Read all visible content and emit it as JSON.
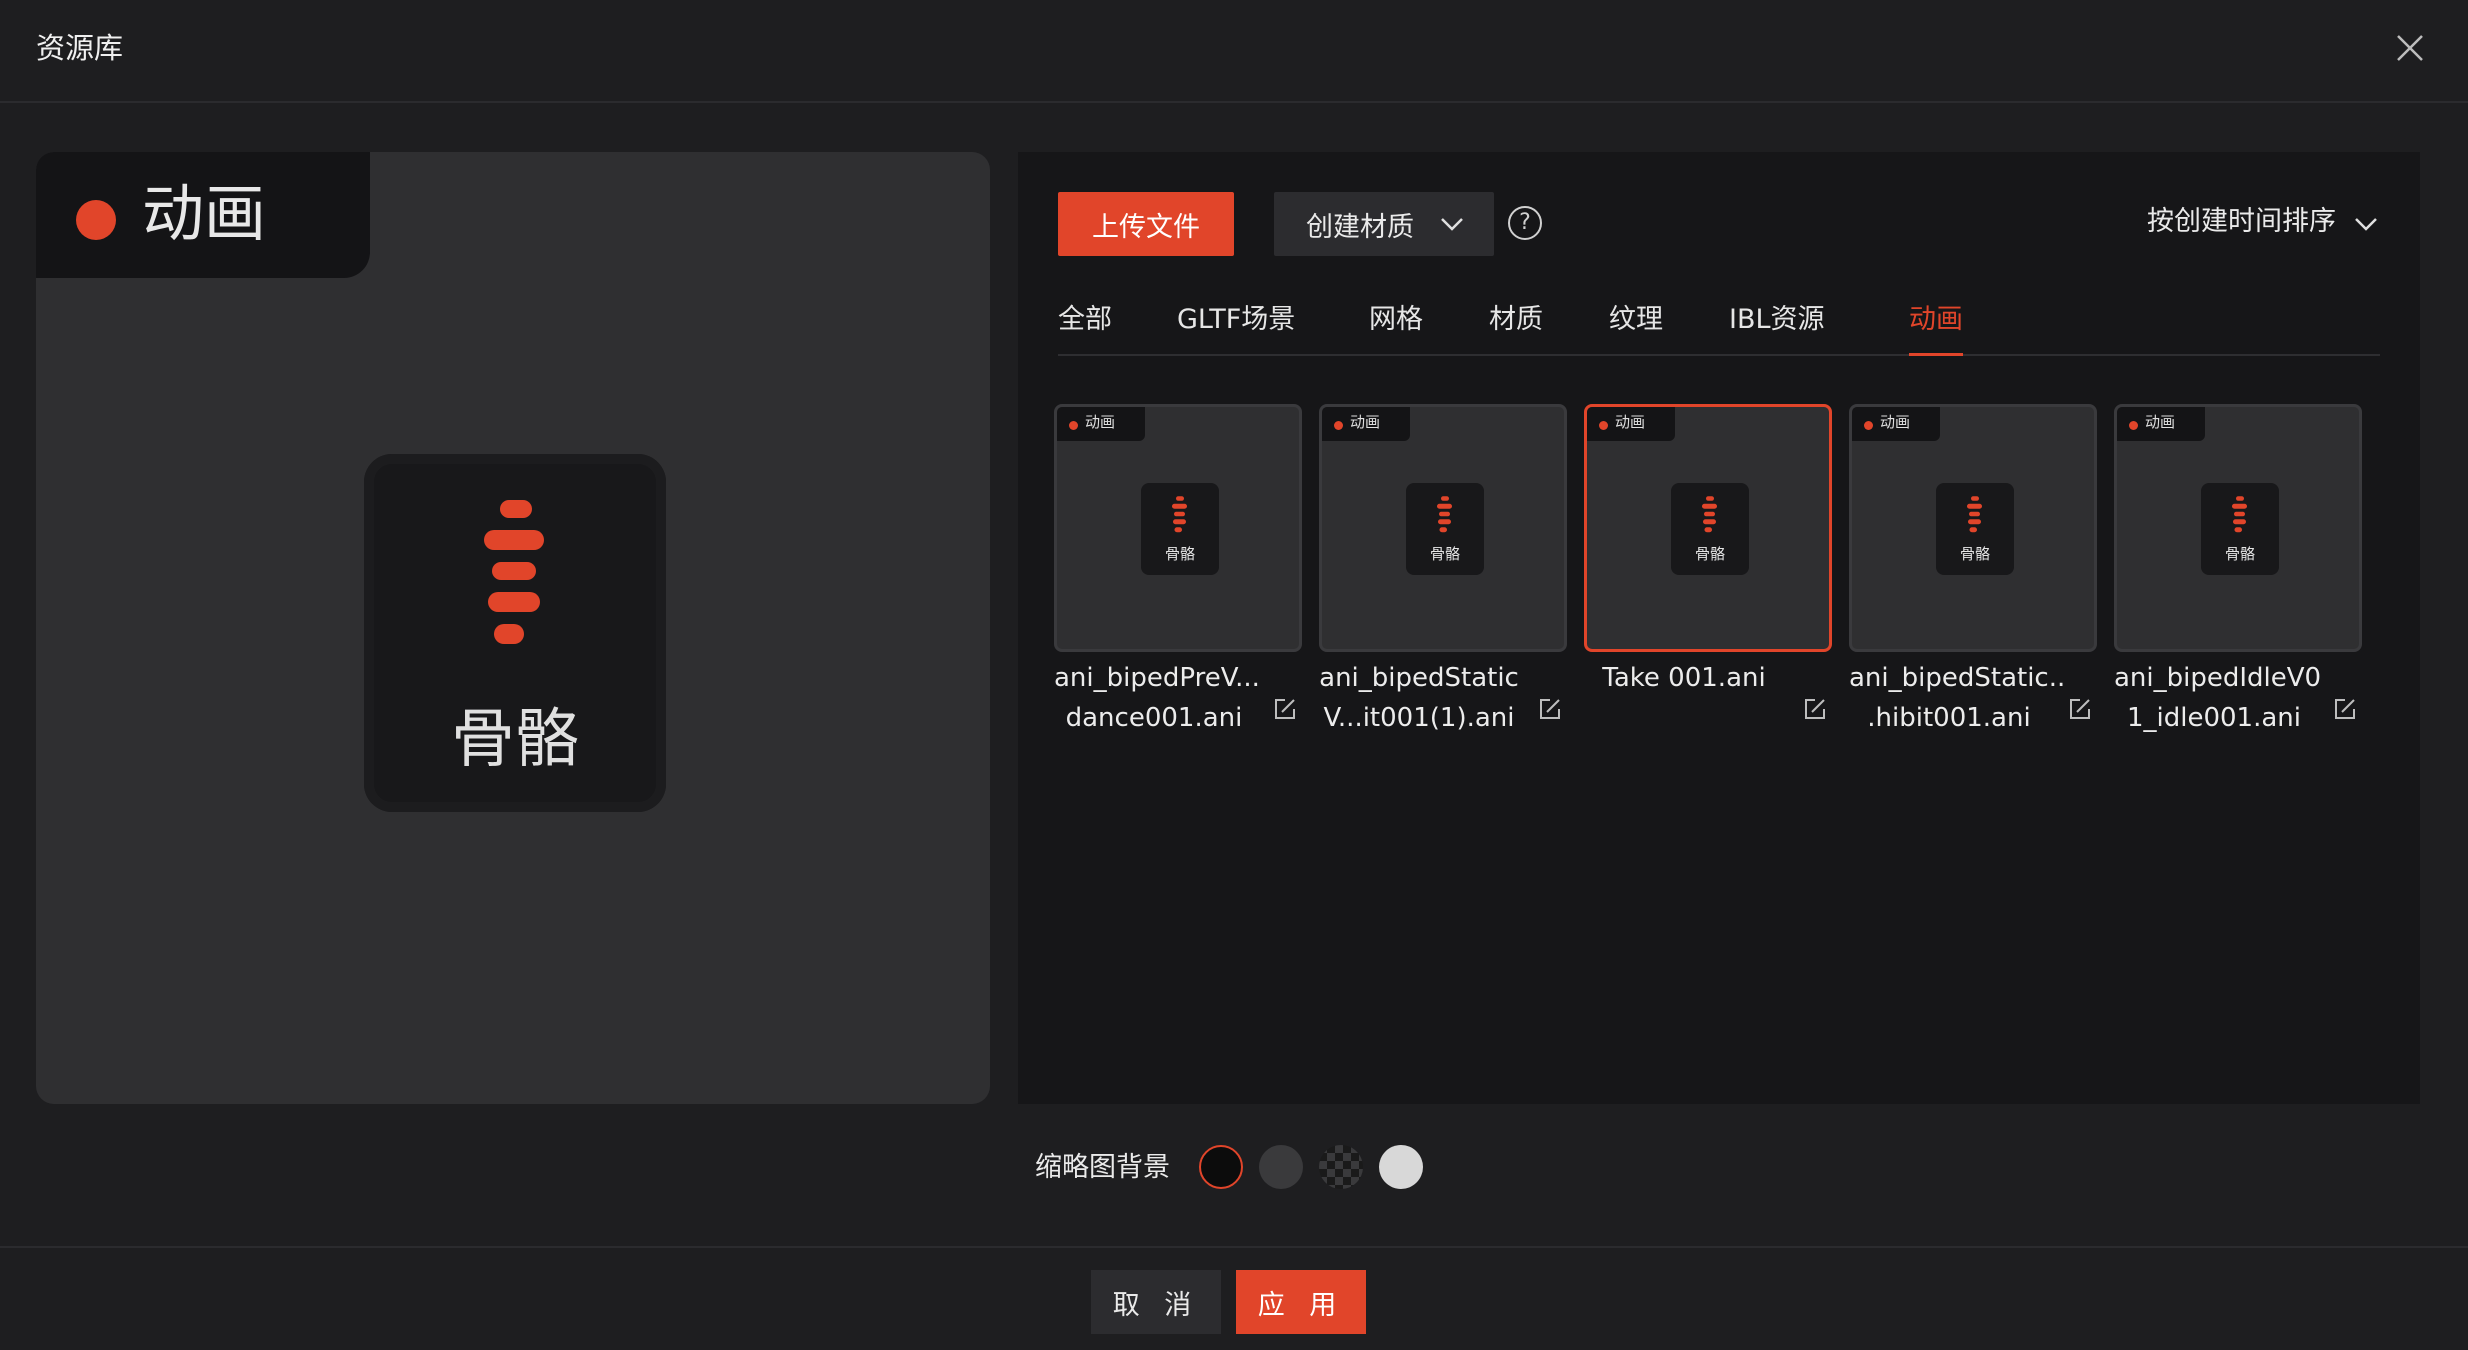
{
  "header": {
    "title": "资源库"
  },
  "preview": {
    "badge": "动画",
    "icon_label": "骨骼"
  },
  "toolbar": {
    "upload_label": "上传文件",
    "create_label": "创建材质",
    "help_glyph": "?",
    "sort_label": "按创建时间排序"
  },
  "tabs": [
    "全部",
    "GLTF场景",
    "网格",
    "材质",
    "纹理",
    "IBL资源",
    "动画"
  ],
  "active_tab": "动画",
  "assets": [
    {
      "badge": "动画",
      "icon_label": "骨骼",
      "name_line1": "ani_bipedPreV...",
      "name_line2": "dance001.ani",
      "selected": false
    },
    {
      "badge": "动画",
      "icon_label": "骨骼",
      "name_line1": "ani_bipedStatic",
      "name_line2": "V...it001(1).ani",
      "selected": false
    },
    {
      "badge": "动画",
      "icon_label": "骨骼",
      "name_line1": "Take 001.ani",
      "name_line2": "",
      "selected": true
    },
    {
      "badge": "动画",
      "icon_label": "骨骼",
      "name_line1": "ani_bipedStatic..",
      "name_line2": ".hibit001.ani",
      "selected": false
    },
    {
      "badge": "动画",
      "icon_label": "骨骼",
      "name_line1": "ani_bipedIdleV0",
      "name_line2": "1_idle001.ani",
      "selected": false
    }
  ],
  "thumbnail_background": {
    "label": "缩略图背景",
    "options": [
      "black",
      "dark-gray",
      "checker",
      "light-gray"
    ],
    "selected": "black"
  },
  "footer": {
    "cancel_label": "取 消",
    "apply_label": "应 用"
  },
  "colors": {
    "accent": "#e1452a",
    "panel": "#161618",
    "dialog": "#1e1e20"
  }
}
